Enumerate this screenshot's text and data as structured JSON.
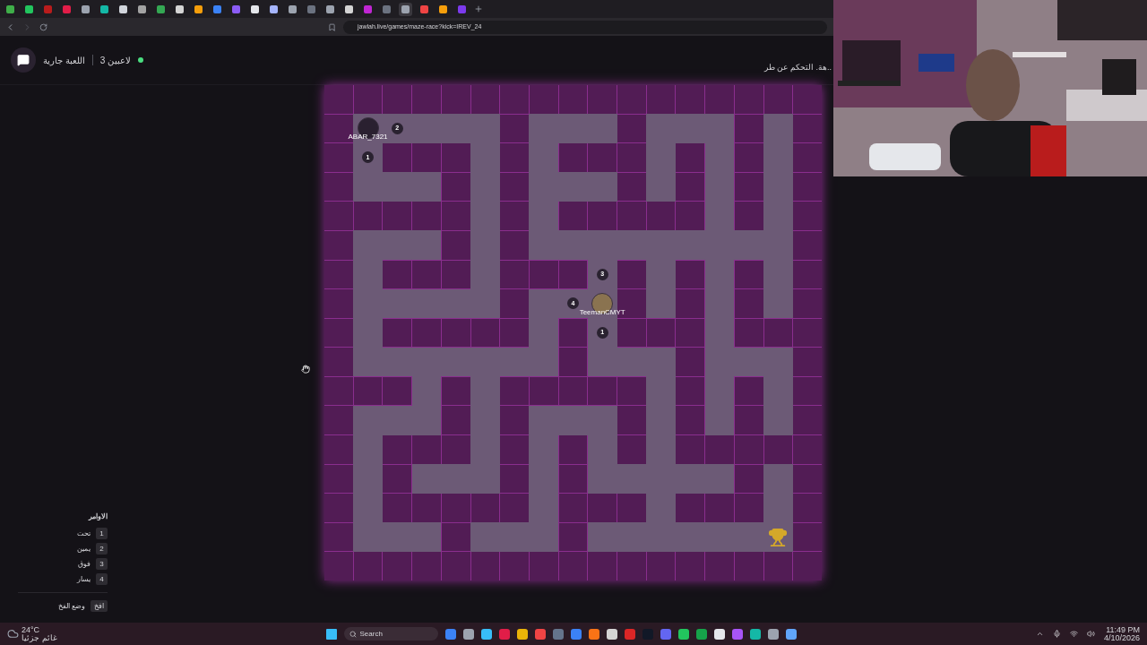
{
  "browser": {
    "tabs": [
      {
        "color": "#3fae49",
        "selected": false
      },
      {
        "color": "#22c55e",
        "selected": false
      },
      {
        "color": "#b91c1c",
        "selected": false
      },
      {
        "color": "#e11d48",
        "selected": false
      },
      {
        "color": "#9ca3af",
        "selected": false
      },
      {
        "color": "#14b8a6",
        "selected": false
      },
      {
        "color": "#d1d5db",
        "selected": false
      },
      {
        "color": "#a3a3a3",
        "selected": false
      },
      {
        "color": "#34a853",
        "selected": false
      },
      {
        "color": "#d4d4d4",
        "selected": false
      },
      {
        "color": "#f59e0b",
        "selected": false
      },
      {
        "color": "#3b82f6",
        "selected": false
      },
      {
        "color": "#8b5cf6",
        "selected": false
      },
      {
        "color": "#e5e7eb",
        "selected": false
      },
      {
        "color": "#a5b4fc",
        "selected": false
      },
      {
        "color": "#9ca3af",
        "selected": false
      },
      {
        "color": "#6b7280",
        "selected": false
      },
      {
        "color": "#9ca3af",
        "selected": false
      },
      {
        "color": "#d4d4d4",
        "selected": false
      },
      {
        "color": "#c026d3",
        "selected": false
      },
      {
        "color": "#6b7280",
        "selected": false
      },
      {
        "color": "#9ca3af",
        "selected": true
      },
      {
        "color": "#ef4444",
        "selected": false
      },
      {
        "color": "#f59e0b",
        "selected": false
      },
      {
        "color": "#7c3aed",
        "selected": false
      }
    ],
    "url": "jawlah.live/games/maze-race?kick=IREV_24"
  },
  "header": {
    "players": "3 لاعبين",
    "status": "اللعبة جارية",
    "live": true,
    "notice": "هة. التحكم عن طر.."
  },
  "maze": {
    "rows": [
      [
        {
          "kind": "wall"
        },
        {
          "kind": "wall"
        },
        {
          "kind": "wall"
        },
        {
          "kind": "wall"
        },
        {
          "kind": "wall"
        },
        {
          "kind": "wall"
        },
        {
          "kind": "wall"
        },
        {
          "kind": "wall"
        },
        {
          "kind": "wall"
        },
        {
          "kind": "wall"
        },
        {
          "kind": "wall"
        },
        {
          "kind": "wall"
        },
        {
          "kind": "wall"
        },
        {
          "kind": "wall"
        },
        {
          "kind": "wall"
        },
        {
          "kind": "wall"
        },
        {
          "kind": "wall"
        }
      ],
      [
        {
          "kind": "wall"
        },
        {
          "kind": "player",
          "name": "ABAR_7321",
          "color": "#2a2030"
        },
        {
          "kind": "marker",
          "label": "2"
        },
        {
          "kind": "path"
        },
        {
          "kind": "path"
        },
        {
          "kind": "path"
        },
        {
          "kind": "wall"
        },
        {
          "kind": "path"
        },
        {
          "kind": "path"
        },
        {
          "kind": "path"
        },
        {
          "kind": "wall"
        },
        {
          "kind": "path"
        },
        {
          "kind": "path"
        },
        {
          "kind": "path"
        },
        {
          "kind": "wall"
        },
        {
          "kind": "path"
        },
        {
          "kind": "wall"
        }
      ],
      [
        {
          "kind": "wall"
        },
        {
          "kind": "marker",
          "label": "1"
        },
        {
          "kind": "wall"
        },
        {
          "kind": "wall"
        },
        {
          "kind": "wall"
        },
        {
          "kind": "path"
        },
        {
          "kind": "wall"
        },
        {
          "kind": "path"
        },
        {
          "kind": "wall"
        },
        {
          "kind": "wall"
        },
        {
          "kind": "wall"
        },
        {
          "kind": "path"
        },
        {
          "kind": "wall"
        },
        {
          "kind": "path"
        },
        {
          "kind": "wall"
        },
        {
          "kind": "path"
        },
        {
          "kind": "wall"
        }
      ],
      [
        {
          "kind": "wall"
        },
        {
          "kind": "path"
        },
        {
          "kind": "path"
        },
        {
          "kind": "path"
        },
        {
          "kind": "wall"
        },
        {
          "kind": "path"
        },
        {
          "kind": "wall"
        },
        {
          "kind": "path"
        },
        {
          "kind": "path"
        },
        {
          "kind": "path"
        },
        {
          "kind": "wall"
        },
        {
          "kind": "path"
        },
        {
          "kind": "wall"
        },
        {
          "kind": "path"
        },
        {
          "kind": "wall"
        },
        {
          "kind": "path"
        },
        {
          "kind": "wall"
        }
      ],
      [
        {
          "kind": "wall"
        },
        {
          "kind": "wall"
        },
        {
          "kind": "wall"
        },
        {
          "kind": "wall"
        },
        {
          "kind": "wall"
        },
        {
          "kind": "path"
        },
        {
          "kind": "wall"
        },
        {
          "kind": "path"
        },
        {
          "kind": "wall"
        },
        {
          "kind": "wall"
        },
        {
          "kind": "wall"
        },
        {
          "kind": "wall"
        },
        {
          "kind": "wall"
        },
        {
          "kind": "path"
        },
        {
          "kind": "wall"
        },
        {
          "kind": "path"
        },
        {
          "kind": "wall"
        }
      ],
      [
        {
          "kind": "wall"
        },
        {
          "kind": "path"
        },
        {
          "kind": "path"
        },
        {
          "kind": "path"
        },
        {
          "kind": "wall"
        },
        {
          "kind": "path"
        },
        {
          "kind": "wall"
        },
        {
          "kind": "path"
        },
        {
          "kind": "path"
        },
        {
          "kind": "path"
        },
        {
          "kind": "path"
        },
        {
          "kind": "path"
        },
        {
          "kind": "path"
        },
        {
          "kind": "path"
        },
        {
          "kind": "path"
        },
        {
          "kind": "path"
        },
        {
          "kind": "wall"
        }
      ],
      [
        {
          "kind": "wall"
        },
        {
          "kind": "path"
        },
        {
          "kind": "wall"
        },
        {
          "kind": "wall"
        },
        {
          "kind": "wall"
        },
        {
          "kind": "path"
        },
        {
          "kind": "wall"
        },
        {
          "kind": "wall"
        },
        {
          "kind": "wall"
        },
        {
          "kind": "marker",
          "label": "3"
        },
        {
          "kind": "wall"
        },
        {
          "kind": "path"
        },
        {
          "kind": "wall"
        },
        {
          "kind": "path"
        },
        {
          "kind": "wall"
        },
        {
          "kind": "path"
        },
        {
          "kind": "wall"
        }
      ],
      [
        {
          "kind": "wall"
        },
        {
          "kind": "path"
        },
        {
          "kind": "path"
        },
        {
          "kind": "path"
        },
        {
          "kind": "path"
        },
        {
          "kind": "path"
        },
        {
          "kind": "wall"
        },
        {
          "kind": "path"
        },
        {
          "kind": "marker",
          "label": "4"
        },
        {
          "kind": "player",
          "name": "TeemanCMYT",
          "color": "#8a7350"
        },
        {
          "kind": "wall"
        },
        {
          "kind": "path"
        },
        {
          "kind": "wall"
        },
        {
          "kind": "path"
        },
        {
          "kind": "wall"
        },
        {
          "kind": "path"
        },
        {
          "kind": "wall"
        }
      ],
      [
        {
          "kind": "wall"
        },
        {
          "kind": "path"
        },
        {
          "kind": "wall"
        },
        {
          "kind": "wall"
        },
        {
          "kind": "wall"
        },
        {
          "kind": "wall"
        },
        {
          "kind": "wall"
        },
        {
          "kind": "path"
        },
        {
          "kind": "wall"
        },
        {
          "kind": "marker",
          "label": "1"
        },
        {
          "kind": "wall"
        },
        {
          "kind": "wall"
        },
        {
          "kind": "wall"
        },
        {
          "kind": "path"
        },
        {
          "kind": "wall"
        },
        {
          "kind": "wall"
        },
        {
          "kind": "wall"
        }
      ],
      [
        {
          "kind": "wall"
        },
        {
          "kind": "path"
        },
        {
          "kind": "path"
        },
        {
          "kind": "path"
        },
        {
          "kind": "path"
        },
        {
          "kind": "path"
        },
        {
          "kind": "path"
        },
        {
          "kind": "path"
        },
        {
          "kind": "wall"
        },
        {
          "kind": "path"
        },
        {
          "kind": "path"
        },
        {
          "kind": "path"
        },
        {
          "kind": "wall"
        },
        {
          "kind": "path"
        },
        {
          "kind": "path"
        },
        {
          "kind": "path"
        },
        {
          "kind": "wall"
        }
      ],
      [
        {
          "kind": "wall"
        },
        {
          "kind": "wall"
        },
        {
          "kind": "wall"
        },
        {
          "kind": "path"
        },
        {
          "kind": "wall"
        },
        {
          "kind": "path"
        },
        {
          "kind": "wall"
        },
        {
          "kind": "wall"
        },
        {
          "kind": "wall"
        },
        {
          "kind": "wall"
        },
        {
          "kind": "wall"
        },
        {
          "kind": "path"
        },
        {
          "kind": "wall"
        },
        {
          "kind": "path"
        },
        {
          "kind": "wall"
        },
        {
          "kind": "path"
        },
        {
          "kind": "wall"
        }
      ],
      [
        {
          "kind": "wall"
        },
        {
          "kind": "path"
        },
        {
          "kind": "path"
        },
        {
          "kind": "path"
        },
        {
          "kind": "wall"
        },
        {
          "kind": "path"
        },
        {
          "kind": "wall"
        },
        {
          "kind": "path"
        },
        {
          "kind": "path"
        },
        {
          "kind": "path"
        },
        {
          "kind": "wall"
        },
        {
          "kind": "path"
        },
        {
          "kind": "wall"
        },
        {
          "kind": "path"
        },
        {
          "kind": "wall"
        },
        {
          "kind": "path"
        },
        {
          "kind": "wall"
        }
      ],
      [
        {
          "kind": "wall"
        },
        {
          "kind": "path"
        },
        {
          "kind": "wall"
        },
        {
          "kind": "wall"
        },
        {
          "kind": "wall"
        },
        {
          "kind": "path"
        },
        {
          "kind": "wall"
        },
        {
          "kind": "path"
        },
        {
          "kind": "wall"
        },
        {
          "kind": "path"
        },
        {
          "kind": "wall"
        },
        {
          "kind": "path"
        },
        {
          "kind": "wall"
        },
        {
          "kind": "wall"
        },
        {
          "kind": "wall"
        },
        {
          "kind": "wall"
        },
        {
          "kind": "wall"
        }
      ],
      [
        {
          "kind": "wall"
        },
        {
          "kind": "path"
        },
        {
          "kind": "wall"
        },
        {
          "kind": "path"
        },
        {
          "kind": "path"
        },
        {
          "kind": "path"
        },
        {
          "kind": "wall"
        },
        {
          "kind": "path"
        },
        {
          "kind": "wall"
        },
        {
          "kind": "path"
        },
        {
          "kind": "path"
        },
        {
          "kind": "path"
        },
        {
          "kind": "path"
        },
        {
          "kind": "path"
        },
        {
          "kind": "wall"
        },
        {
          "kind": "path"
        },
        {
          "kind": "wall"
        }
      ],
      [
        {
          "kind": "wall"
        },
        {
          "kind": "path"
        },
        {
          "kind": "wall"
        },
        {
          "kind": "wall"
        },
        {
          "kind": "wall"
        },
        {
          "kind": "wall"
        },
        {
          "kind": "wall"
        },
        {
          "kind": "path"
        },
        {
          "kind": "wall"
        },
        {
          "kind": "wall"
        },
        {
          "kind": "wall"
        },
        {
          "kind": "path"
        },
        {
          "kind": "wall"
        },
        {
          "kind": "wall"
        },
        {
          "kind": "wall"
        },
        {
          "kind": "path"
        },
        {
          "kind": "wall"
        }
      ],
      [
        {
          "kind": "wall"
        },
        {
          "kind": "path"
        },
        {
          "kind": "path"
        },
        {
          "kind": "path"
        },
        {
          "kind": "wall"
        },
        {
          "kind": "path"
        },
        {
          "kind": "path"
        },
        {
          "kind": "path"
        },
        {
          "kind": "wall"
        },
        {
          "kind": "path"
        },
        {
          "kind": "path"
        },
        {
          "kind": "path"
        },
        {
          "kind": "path"
        },
        {
          "kind": "path"
        },
        {
          "kind": "path"
        },
        {
          "kind": "goal"
        },
        {
          "kind": "wall"
        }
      ],
      [
        {
          "kind": "wall"
        },
        {
          "kind": "wall"
        },
        {
          "kind": "wall"
        },
        {
          "kind": "wall"
        },
        {
          "kind": "wall"
        },
        {
          "kind": "wall"
        },
        {
          "kind": "wall"
        },
        {
          "kind": "wall"
        },
        {
          "kind": "wall"
        },
        {
          "kind": "wall"
        },
        {
          "kind": "wall"
        },
        {
          "kind": "wall"
        },
        {
          "kind": "wall"
        },
        {
          "kind": "wall"
        },
        {
          "kind": "wall"
        },
        {
          "kind": "wall"
        },
        {
          "kind": "wall"
        }
      ]
    ]
  },
  "commands": {
    "title": "الاوامر",
    "items": [
      {
        "key": "1",
        "label": "تحت"
      },
      {
        "key": "2",
        "label": "يمين"
      },
      {
        "key": "3",
        "label": "فوق"
      },
      {
        "key": "4",
        "label": "يسار"
      }
    ],
    "trap": {
      "key": "افخ",
      "label": "وضع الفخ"
    }
  },
  "taskbar": {
    "temperature": "24°C",
    "weather": "غائم جزئيا",
    "search": "Search",
    "apps": [
      {
        "color": "#3b82f6"
      },
      {
        "color": "#9ca3af"
      },
      {
        "color": "#38bdf8"
      },
      {
        "color": "#e11d48"
      },
      {
        "color": "#eab308"
      },
      {
        "color": "#ef4444"
      },
      {
        "color": "#64748b"
      },
      {
        "color": "#3b82f6"
      },
      {
        "color": "#f97316"
      },
      {
        "color": "#d4d4d4"
      },
      {
        "color": "#dc2626"
      },
      {
        "color": "#111827"
      },
      {
        "color": "#6366f1"
      },
      {
        "color": "#22c55e"
      },
      {
        "color": "#16a34a"
      },
      {
        "color": "#e5e7eb"
      },
      {
        "color": "#a855f7"
      },
      {
        "color": "#14b8a6"
      },
      {
        "color": "#9ca3af"
      },
      {
        "color": "#60a5fa"
      }
    ],
    "time": "11:49 PM",
    "date": "4/10/2026"
  }
}
